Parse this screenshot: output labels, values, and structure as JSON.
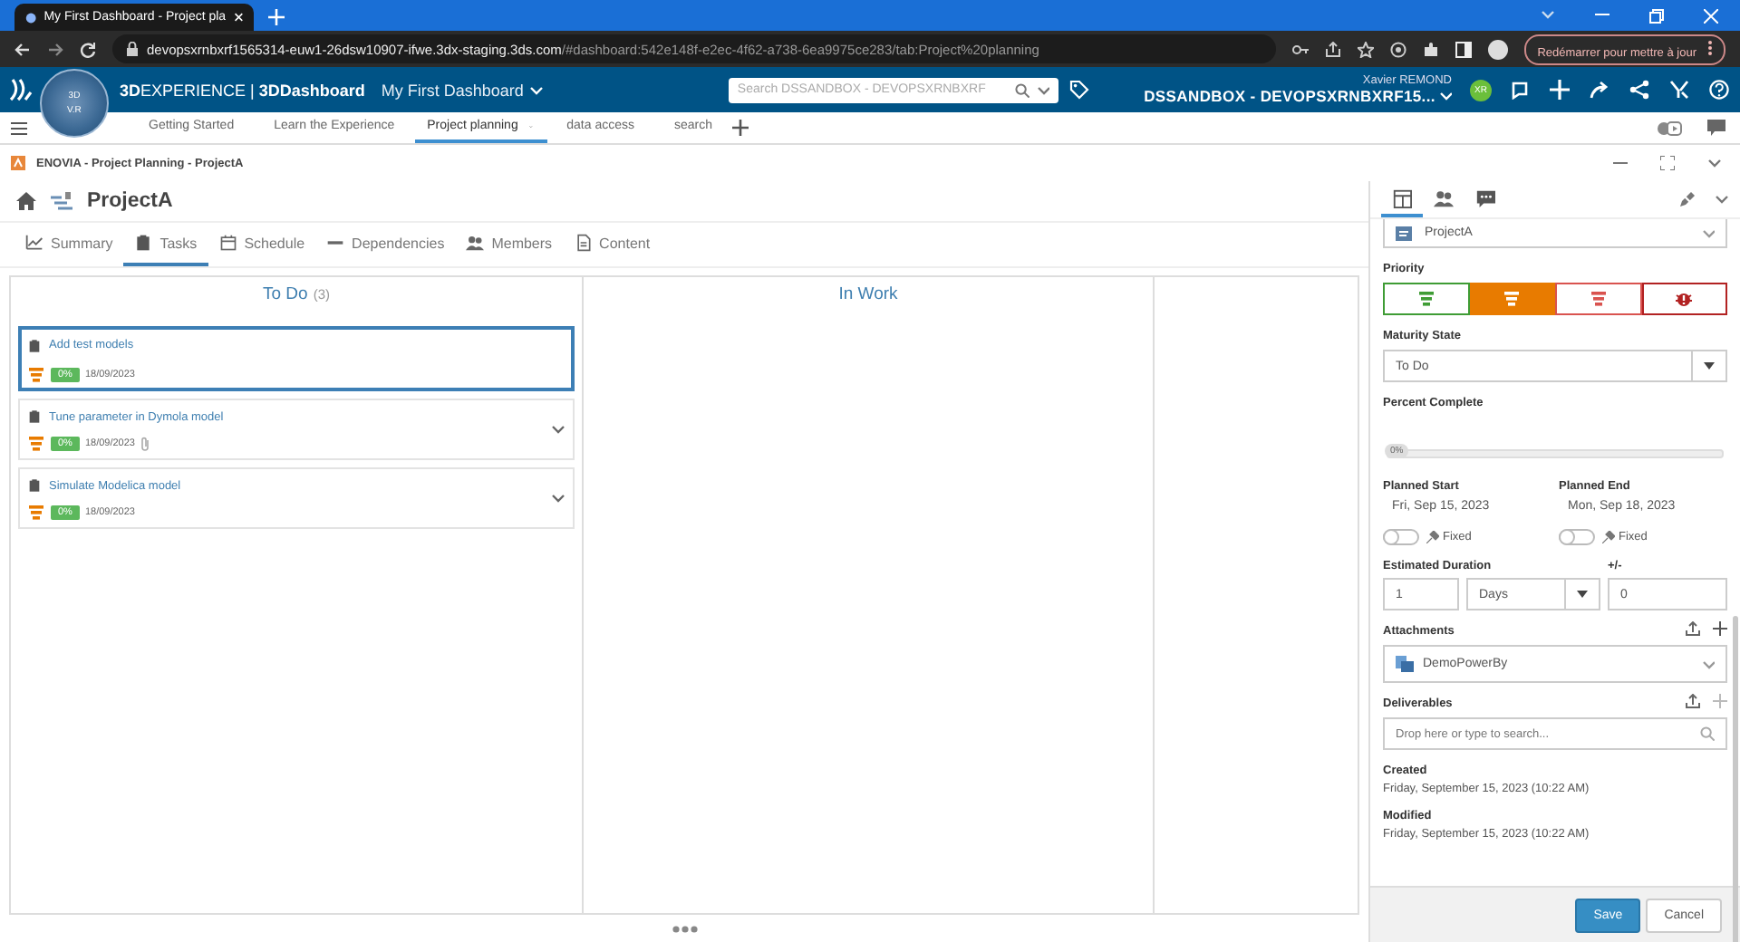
{
  "browser": {
    "tab_title": "My First Dashboard - Project pla",
    "url_host": "devopsxrnbxrf1565314-euw1-26dsw10907-ifwe.3dx-staging.3ds.com",
    "url_path": "/#dashboard:542e148f-e2ec-4f62-a738-6ea9975ce283/tab:Project%20planning",
    "update_button": "Redémarrer pour mettre à jour"
  },
  "header": {
    "compass": [
      "3D",
      "V.R"
    ],
    "brand": "**3D**EXPERIENCE | **3DDashboard**",
    "dashboard": "My First Dashboard",
    "search_placeholder": "Search DSSANDBOX - DEVOPSXRNBXRF",
    "user": "Xavier REMOND",
    "tenant": "DSSANDBOX - DEVOPSXRNBXRF15...",
    "avatar": "XR"
  },
  "dashboard_tabs": [
    {
      "label": "Getting Started",
      "selected": false
    },
    {
      "label": "Learn the Experience",
      "selected": false
    },
    {
      "label": "Project planning",
      "selected": true
    },
    {
      "label": "data access",
      "selected": false
    },
    {
      "label": "search",
      "selected": false
    }
  ],
  "widget": {
    "title": "ENOVIA - Project Planning - ProjectA"
  },
  "project": {
    "name": "ProjectA",
    "tabs": [
      {
        "label": "Summary",
        "selected": false
      },
      {
        "label": "Tasks",
        "selected": true
      },
      {
        "label": "Schedule",
        "selected": false
      },
      {
        "label": "Dependencies",
        "selected": false
      },
      {
        "label": "Members",
        "selected": false
      },
      {
        "label": "Content",
        "selected": false
      }
    ]
  },
  "board": {
    "columns": [
      {
        "title": "To Do",
        "count": "(3)",
        "cards": [
          {
            "title": "Add test models",
            "kind": "medium",
            "progress": "0%",
            "due": "18/09/2023",
            "attachment": false,
            "expandable": false,
            "selected": true
          },
          {
            "title": "Tune parameter in Dymola model",
            "kind": "medium",
            "progress": "0%",
            "due": "18/09/2023",
            "attachment": true,
            "expandable": true,
            "selected": false
          },
          {
            "title": "Simulate Modelica model",
            "kind": "medium",
            "progress": "0%",
            "due": "18/09/2023",
            "attachment": false,
            "expandable": true,
            "selected": false
          }
        ]
      },
      {
        "title": "In Work"
      }
    ]
  },
  "panel": {
    "tabs": [
      {
        "selected": true
      },
      {
        "selected": false
      },
      {
        "selected": false
      }
    ],
    "project": "ProjectA",
    "priority": {
      "label": "Priority",
      "options": [
        {
          "kind": "low",
          "selected": false
        },
        {
          "kind": "medium",
          "selected": true
        },
        {
          "kind": "high",
          "selected": false
        },
        {
          "kind": "critical",
          "selected": false
        }
      ]
    },
    "maturity": {
      "label": "Maturity State",
      "value": "To Do"
    },
    "percent": {
      "label": "Percent Complete",
      "level": 0,
      "reading": "0%"
    },
    "dates": [
      {
        "label": "Planned Start",
        "value": "Fri, Sep 15, 2023",
        "fixed": false,
        "fixed_label": "Fixed"
      },
      {
        "label": "Planned End",
        "value": "Mon, Sep 18, 2023",
        "fixed": false,
        "fixed_label": "Fixed"
      }
    ],
    "duration": {
      "label": "Estimated Duration",
      "value": "1",
      "unit": "Days",
      "delta_label": "+/-",
      "delta": "0"
    },
    "attachments": {
      "label": "Attachments",
      "items": [
        "DemoPowerBy"
      ]
    },
    "deliverables": {
      "label": "Deliverables",
      "placeholder": "Drop here or type to search..."
    },
    "created": {
      "label": "Created",
      "value": "Friday, September 15, 2023 (10:22 AM)"
    },
    "modified": {
      "label": "Modified",
      "value": "Friday, September 15, 2023 (10:22 AM)"
    },
    "buttons": [
      {
        "label": "Save",
        "kind": "primary"
      },
      {
        "label": "Cancel",
        "kind": "secondary"
      }
    ]
  }
}
